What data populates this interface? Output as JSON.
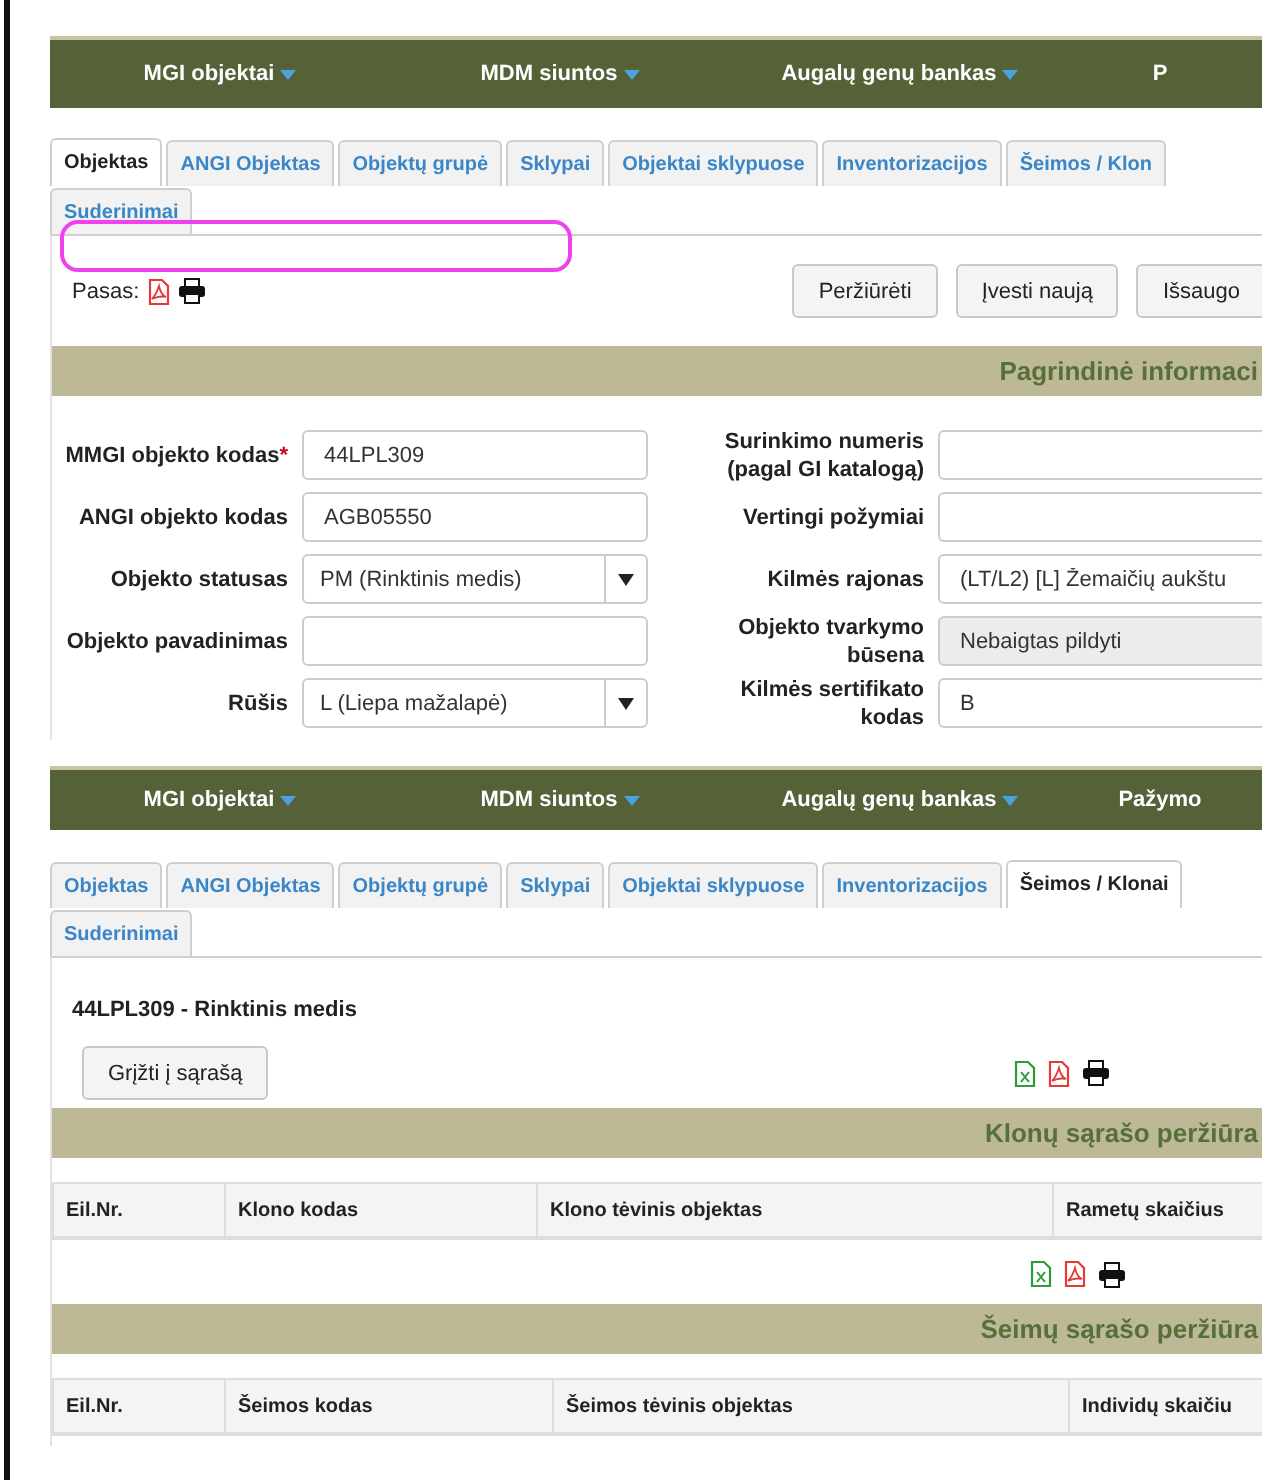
{
  "top_view": {
    "nav": [
      {
        "label": "MGI objektai",
        "has_menu": true
      },
      {
        "label": "MDM siuntos",
        "has_menu": true
      },
      {
        "label": "Augalų genų bankas",
        "has_menu": true
      },
      {
        "label": "P",
        "has_menu": false
      }
    ],
    "tab_rows": [
      [
        {
          "label": "Objektas",
          "selected": true
        },
        {
          "label": "ANGI Objektas",
          "selected": false
        },
        {
          "label": "Objektų grupė",
          "selected": false
        },
        {
          "label": "Sklypai",
          "selected": false
        },
        {
          "label": "Objektai sklypuose",
          "selected": false
        },
        {
          "label": "Inventorizacijos",
          "selected": false
        },
        {
          "label": "Šeimos / Klon",
          "selected": false
        }
      ],
      [
        {
          "label": "Suderinimai",
          "selected": false
        }
      ]
    ],
    "passport_label": "Pasas:",
    "buttons": [
      "Peržiūrėti",
      "Įvesti naują",
      "Išsaugo"
    ],
    "section_title": "Pagrindinė informaci",
    "left_fields": [
      {
        "label": "MMGI objekto kodas",
        "required_mark": "*",
        "kind": "text",
        "value": "44LPL309"
      },
      {
        "label": "ANGI objekto kodas",
        "kind": "text",
        "value": "AGB05550"
      },
      {
        "label": "Objekto statusas",
        "kind": "select",
        "value": "PM (Rinktinis medis)"
      },
      {
        "label": "Objekto pavadinimas",
        "kind": "text"
      },
      {
        "label": "Rūšis",
        "kind": "select",
        "value": "L (Liepa mažalapė)"
      }
    ],
    "right_fields": [
      {
        "label": "Surinkimo numeris (pagal GI katalogą)",
        "disabled": false
      },
      {
        "label": "Vertingi požymiai",
        "disabled": false
      },
      {
        "label": "Kilmės rajonas",
        "value": "(LT/L2) [L] Žemaičių aukštu",
        "disabled": false
      },
      {
        "label": "Objekto tvarkymo būsena",
        "value": "Nebaigtas pildyti",
        "disabled": true
      },
      {
        "label": "Kilmės sertifikato kodas",
        "value": "B",
        "disabled": false
      }
    ]
  },
  "bottom_view": {
    "nav": [
      {
        "label": "MGI objektai",
        "has_menu": true
      },
      {
        "label": "MDM siuntos",
        "has_menu": true
      },
      {
        "label": "Augalų genų bankas",
        "has_menu": true
      },
      {
        "label": "Pažymo",
        "has_menu": false
      }
    ],
    "tab_rows": [
      [
        {
          "label": "Objektas",
          "selected": false
        },
        {
          "label": "ANGI Objektas",
          "selected": false
        },
        {
          "label": "Objektų grupė",
          "selected": false
        },
        {
          "label": "Sklypai",
          "selected": false
        },
        {
          "label": "Objektai sklypuose",
          "selected": false
        },
        {
          "label": "Inventorizacijos",
          "selected": false
        },
        {
          "label": "Šeimos / Klonai",
          "selected": true
        }
      ],
      [
        {
          "label": "Suderinimai",
          "selected": false
        }
      ]
    ],
    "object_title": "44LPL309 - Rinktinis medis",
    "back_button": "Grįžti į sąrašą",
    "tables": [
      {
        "title": "Klonų sąrašo peržiūra",
        "columns": [
          "Eil.Nr.",
          "Klono kodas",
          "Klono tėvinis objektas",
          "Rametų skaičius"
        ]
      },
      {
        "title": "Šeimų sąrašo peržiūra",
        "columns": [
          "Eil.Nr.",
          "Šeimos kodas",
          "Šeimos tėvinis objektas",
          "Individų skaičiu"
        ]
      }
    ]
  }
}
